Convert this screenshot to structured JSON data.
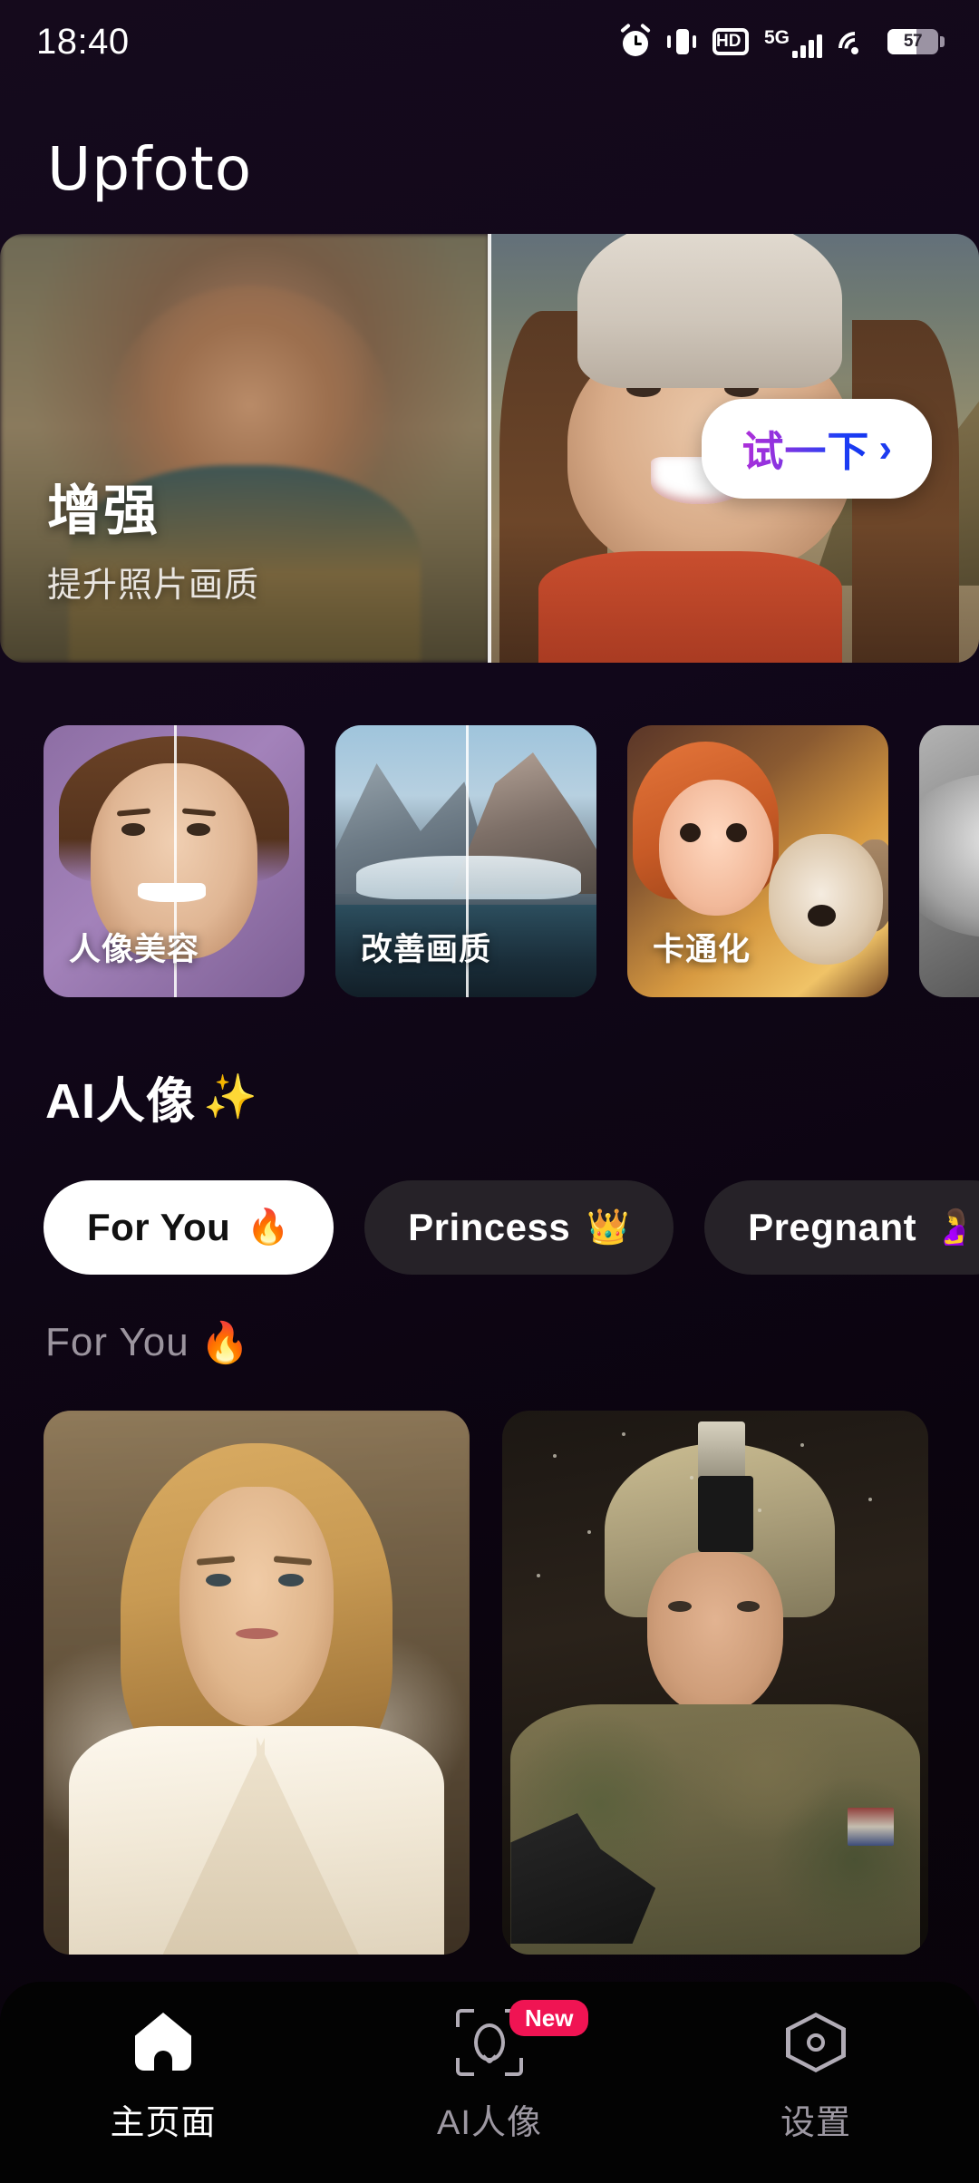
{
  "status_bar": {
    "time": "18:40",
    "battery_percent": "57",
    "battery_level": 57,
    "network_label": "5G",
    "hd_label": "HD",
    "icons": [
      "alarm-icon",
      "vibrate-icon",
      "hd-icon",
      "5g-signal-icon",
      "wifi-icon",
      "battery-icon"
    ]
  },
  "header": {
    "app_name": "Upfoto"
  },
  "hero_banner": {
    "title": "增强",
    "subtitle": "提升照片画质",
    "cta_label": "试一下",
    "cta_chevron": "›",
    "cta_gradient_from": "#b12fd8",
    "cta_gradient_to": "#1133ee",
    "comparison": "before-after-split"
  },
  "feature_cards": [
    {
      "label": "人像美容",
      "theme": "portrait-beauty"
    },
    {
      "label": "改善画质",
      "theme": "improve-quality"
    },
    {
      "label": "卡通化",
      "theme": "cartoonize"
    },
    {
      "label": "",
      "theme": "grayscale-partial"
    }
  ],
  "ai_section": {
    "title": "AI人像",
    "title_emoji": "✨",
    "chips": [
      {
        "label": "For You",
        "emoji": "🔥",
        "active": true
      },
      {
        "label": "Princess",
        "emoji": "👑",
        "active": false
      },
      {
        "label": "Pregnant",
        "emoji": "🤰",
        "active": false
      }
    ],
    "sub_label": "For You",
    "sub_label_emoji": "🔥"
  },
  "content_grid": [
    {
      "alt": "blonde-woman-white-blazer"
    },
    {
      "alt": "soldier-camouflage-helmet"
    }
  ],
  "bottom_nav": [
    {
      "label": "主页面",
      "icon": "home-icon",
      "active": true,
      "badge": ""
    },
    {
      "label": "AI人像",
      "icon": "face-scan-icon",
      "active": false,
      "badge": "New"
    },
    {
      "label": "设置",
      "icon": "settings-gear-icon",
      "active": false,
      "badge": ""
    }
  ],
  "colors": {
    "background": "#11071a",
    "nav_background": "#030303",
    "badge": "#f01453",
    "chip_active_bg": "#ffffff",
    "chip_idle_bg": "#262228",
    "muted_text": "#9b949e"
  }
}
